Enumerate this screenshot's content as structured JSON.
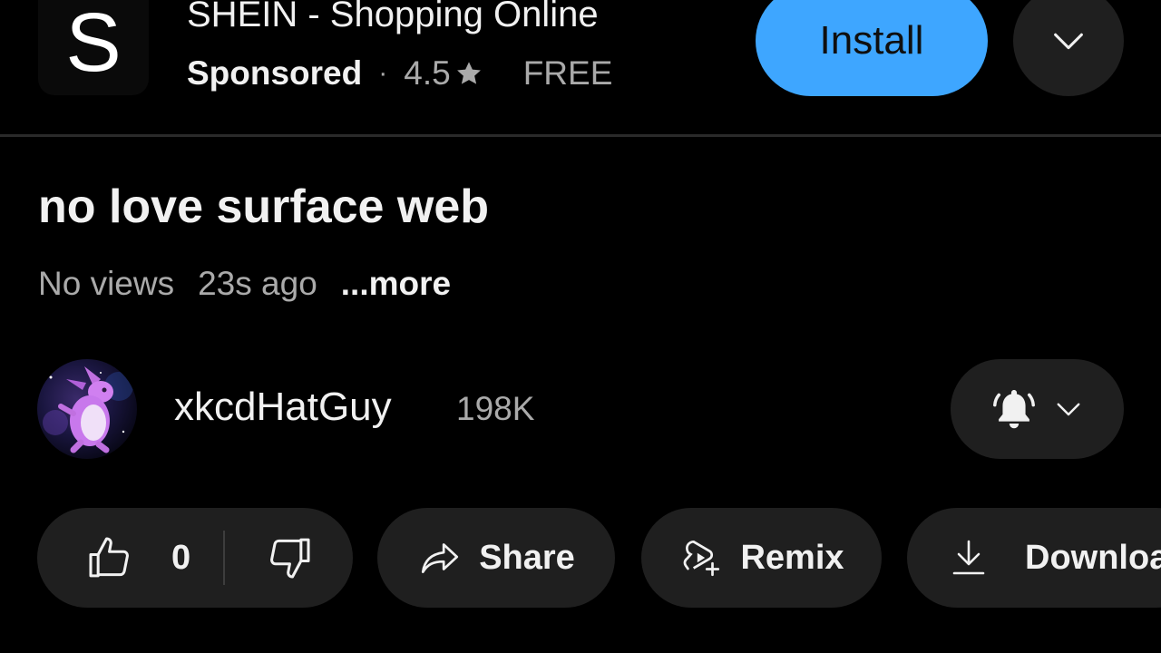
{
  "ad": {
    "logo_letter": "S",
    "title": "SHEIN - Shopping Online",
    "sponsored": "Sponsored",
    "separator": "·",
    "rating": "4.5",
    "price": "FREE",
    "install_label": "Install",
    "colors": {
      "install_bg": "#3ea6ff"
    },
    "icons": {
      "rating": "star-icon",
      "more": "chevron-down-icon"
    }
  },
  "video": {
    "title": "no love surface web",
    "views": "No views",
    "age": "23s ago",
    "more": "...more"
  },
  "channel": {
    "name": "xkcdHatGuy",
    "subscribers": "198K",
    "icons": {
      "avatar": "purple-creature-avatar",
      "notifications": "bell-icon",
      "menu": "chevron-down-icon"
    }
  },
  "actions": {
    "like_count": "0",
    "share_label": "Share",
    "remix_label": "Remix",
    "download_label": "Downloa",
    "icons": {
      "like": "thumbs-up-icon",
      "dislike": "thumbs-down-icon",
      "share": "share-arrow-icon",
      "remix": "remix-icon",
      "download": "download-icon"
    }
  }
}
